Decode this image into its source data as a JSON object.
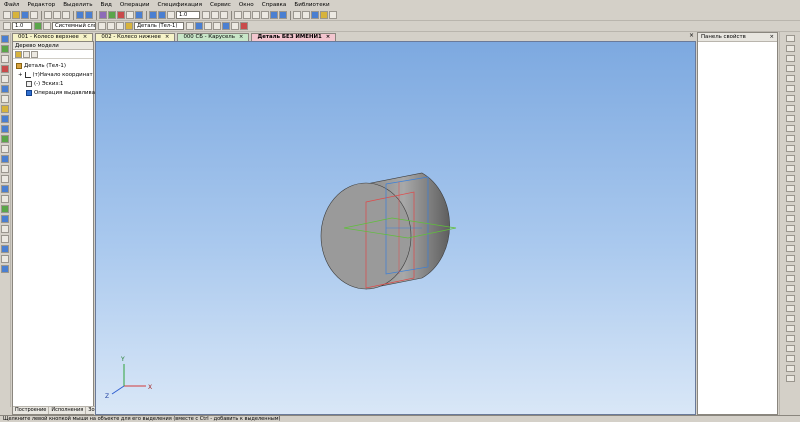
{
  "menu": [
    "Файл",
    "Редактор",
    "Выделить",
    "Вид",
    "Операции",
    "Спецификация",
    "Сервис",
    "Окно",
    "Справка",
    "Библиотеки"
  ],
  "toolbar": {
    "zoom_value": "1.0",
    "zoom_value2": "1.0",
    "layer_select": "Системный слой (0)",
    "detail_select": "Деталь (Тел-1)"
  },
  "tabs": [
    {
      "label": "001 - Колесо верхнее",
      "close": "×"
    },
    {
      "label": "002 - Колесо нижнее",
      "close": "×"
    },
    {
      "label": "000 СБ - Карусель",
      "close": "×"
    },
    {
      "label": "Деталь БЕЗ ИМЕНИ1",
      "close": "×"
    }
  ],
  "tabs_close": "×",
  "tree": {
    "title": "Дерево модели",
    "items": [
      {
        "label": "Деталь (Тел-1)",
        "icon": "part-icon"
      },
      {
        "label": "(т)Начало координат",
        "icon": "origin-icon"
      },
      {
        "label": "(-) Эскиз:1",
        "icon": "sketch-icon"
      },
      {
        "label": "Операция выдавливания",
        "icon": "extrude-icon"
      }
    ],
    "expander": "+",
    "bottom_tabs": [
      "Построение",
      "Исполнения",
      "Зоны"
    ]
  },
  "properties_panel": {
    "title": "Панель свойств",
    "close": "×"
  },
  "axes": {
    "x": "X",
    "y": "Y",
    "z": "Z"
  },
  "status_text": "Щелкните левой кнопкой мыши на объекте для его выделения (вместе с Ctrl - добавить к выделенным)"
}
